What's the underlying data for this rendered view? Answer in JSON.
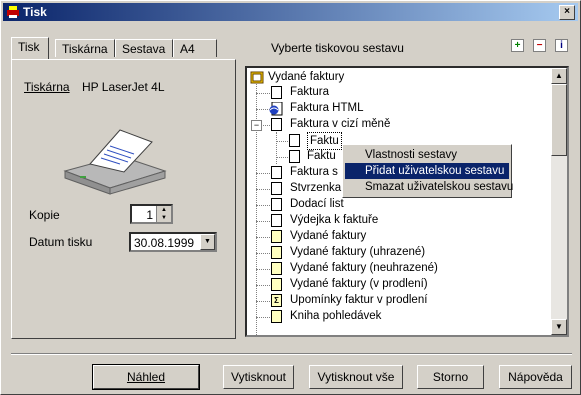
{
  "window": {
    "title": "Tisk",
    "close_glyph": "×"
  },
  "tabs": [
    {
      "label": "Tisk",
      "active": true
    },
    {
      "label": "Tiskárna",
      "active": false
    },
    {
      "label": "Sestava",
      "active": false
    },
    {
      "label": "A4",
      "active": false
    }
  ],
  "printer": {
    "label": "Tiskárna",
    "name": "HP LaserJet 4L"
  },
  "copies": {
    "label": "Kopie",
    "value": "1"
  },
  "print_date": {
    "label": "Datum tisku",
    "value": "30.08.1999"
  },
  "report_header": {
    "title": "Vyberte tiskovou sestavu",
    "add_icon": "+",
    "remove_icon": "−",
    "info_icon": "i"
  },
  "tree": {
    "root": "Vydané faktury",
    "items": [
      {
        "label": "Faktura",
        "icon": "doc"
      },
      {
        "label": "Faktura HTML",
        "icon": "html-doc"
      },
      {
        "label": "Faktura v cizí měně",
        "icon": "doc",
        "expanded": true
      },
      {
        "label": "Faktu",
        "icon": "doc",
        "child": true,
        "selected": true
      },
      {
        "label": "Faktu",
        "icon": "doc",
        "child": true
      },
      {
        "label": "Faktura s",
        "icon": "doc"
      },
      {
        "label": "Stvrzenka",
        "icon": "doc"
      },
      {
        "label": "Dodací list",
        "icon": "doc"
      },
      {
        "label": "Výdejka k faktuře",
        "icon": "doc"
      },
      {
        "label": "Vydané faktury",
        "icon": "yellow-doc"
      },
      {
        "label": "Vydané faktury (uhrazené)",
        "icon": "yellow-doc"
      },
      {
        "label": "Vydané faktury (neuhrazené)",
        "icon": "yellow-doc"
      },
      {
        "label": "Vydané faktury (v prodlení)",
        "icon": "yellow-doc"
      },
      {
        "label": "Upomínky faktur v prodlení",
        "icon": "sigma-doc"
      },
      {
        "label": "Kniha pohledávek",
        "icon": "yellow-doc"
      }
    ]
  },
  "context_menu": {
    "items": [
      {
        "label": "Vlastnosti sestavy",
        "selected": false
      },
      {
        "label": "Přidat uživatelskou sestavu",
        "selected": true
      },
      {
        "label": "Smazat uživatelskou sestavu",
        "selected": false
      }
    ]
  },
  "buttons": {
    "preview": "Náhled",
    "print": "Vytisknout",
    "print_all": "Vytisknout vše",
    "cancel": "Storno",
    "help": "Nápověda"
  }
}
